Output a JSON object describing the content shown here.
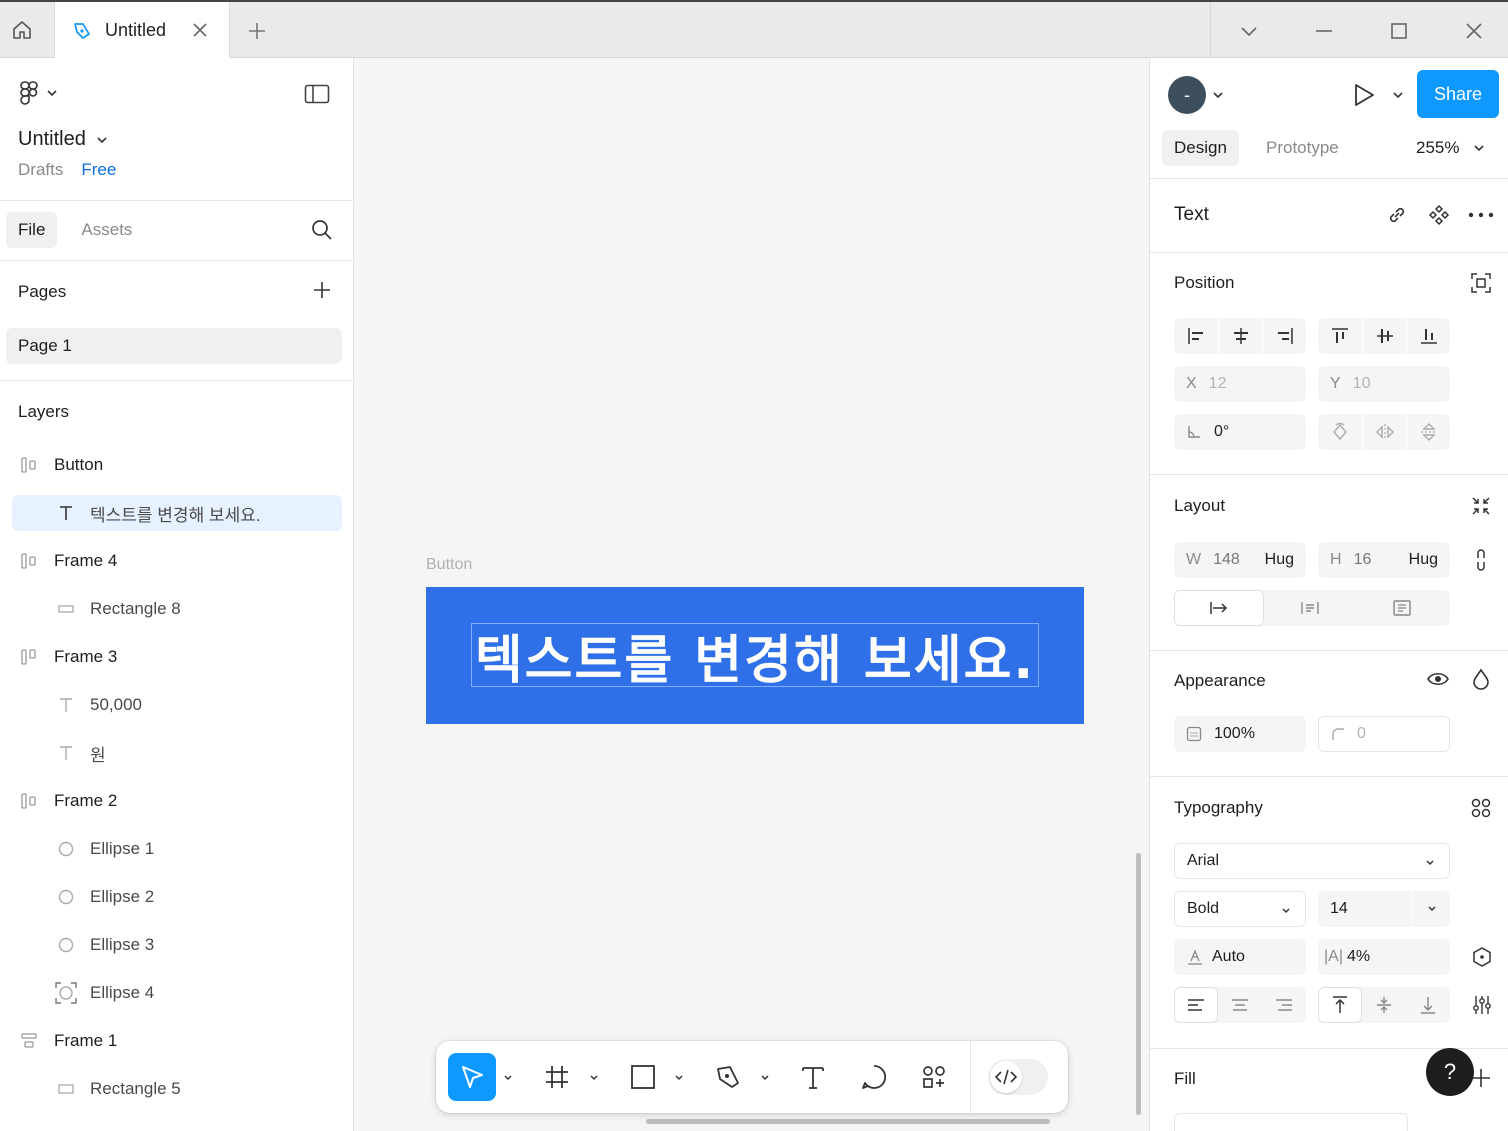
{
  "window": {
    "tab_title": "Untitled",
    "icons": [
      "home-icon",
      "figma-file-icon",
      "close-icon",
      "plus-icon",
      "chevron-down-icon",
      "minimize-icon",
      "maximize-icon",
      "window-close-icon"
    ]
  },
  "left_panel": {
    "file_name": "Untitled",
    "location": "Drafts",
    "plan": "Free",
    "tabs": [
      "File",
      "Assets"
    ],
    "pages_heading": "Pages",
    "pages": [
      "Page 1"
    ],
    "layers_heading": "Layers",
    "layers": [
      {
        "name": "Button",
        "kind": "frame",
        "icon": "autolayout-horizontal-icon"
      },
      {
        "name": "텍스트를 변경해 보세요.",
        "kind": "child",
        "icon": "text-icon",
        "selected": true
      },
      {
        "name": "Frame 4",
        "kind": "frame",
        "icon": "autolayout-horizontal-icon"
      },
      {
        "name": "Rectangle 8",
        "kind": "child",
        "icon": "rectangle-icon"
      },
      {
        "name": "Frame 3",
        "kind": "frame",
        "icon": "autolayout-horizontal-icon"
      },
      {
        "name": "50,000",
        "kind": "child",
        "icon": "text-icon"
      },
      {
        "name": "원",
        "kind": "child",
        "icon": "text-icon"
      },
      {
        "name": "Frame 2",
        "kind": "frame",
        "icon": "autolayout-horizontal-icon"
      },
      {
        "name": "Ellipse 1",
        "kind": "child",
        "icon": "ellipse-icon"
      },
      {
        "name": "Ellipse 2",
        "kind": "child",
        "icon": "ellipse-icon"
      },
      {
        "name": "Ellipse 3",
        "kind": "child",
        "icon": "ellipse-icon"
      },
      {
        "name": "Ellipse 4",
        "kind": "child",
        "icon": "ellipse-frame-icon"
      },
      {
        "name": "Frame 1",
        "kind": "frame",
        "icon": "autolayout-vertical-icon"
      },
      {
        "name": "Rectangle 5",
        "kind": "child",
        "icon": "rectangle-icon"
      }
    ]
  },
  "canvas": {
    "frame_label": "Button",
    "button_text": "텍스트를 변경해 보세요.",
    "button_color": "#2F6FE8",
    "toolbar": [
      "move-tool-icon",
      "frame-tool-icon",
      "rectangle-tool-icon",
      "pen-tool-icon",
      "text-tool-icon",
      "comment-tool-icon",
      "actions-icon",
      "dev-mode-icon"
    ]
  },
  "right_panel": {
    "avatar_initial": "-",
    "share_label": "Share",
    "tabs": [
      "Design",
      "Prototype"
    ],
    "zoom": "255%",
    "selection_heading": "Text",
    "position": {
      "heading": "Position",
      "x_label": "X",
      "x": "12",
      "y_label": "Y",
      "y": "10",
      "rotation": "0°"
    },
    "layout": {
      "heading": "Layout",
      "w_label": "W",
      "w": "148",
      "w_mode": "Hug",
      "h_label": "H",
      "h": "16",
      "h_mode": "Hug"
    },
    "appearance": {
      "heading": "Appearance",
      "opacity": "100%",
      "radius": "0"
    },
    "typography": {
      "heading": "Typography",
      "font": "Arial",
      "weight": "Bold",
      "size": "14",
      "line_height": "Auto",
      "letter_spacing_prefix": "|A|",
      "letter_spacing": "4%"
    },
    "fill": {
      "heading": "Fill"
    },
    "accent_color": "#0D99FF"
  },
  "help_label": "?"
}
